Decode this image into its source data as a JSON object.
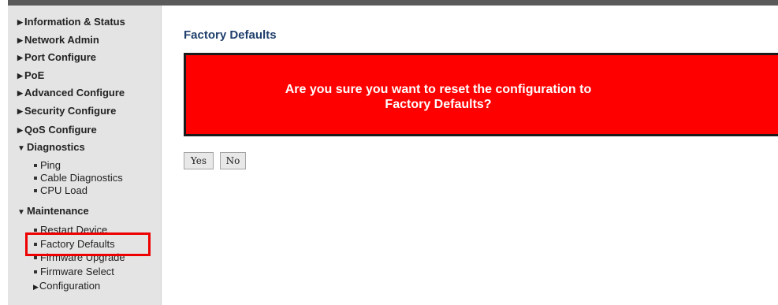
{
  "sidebar": {
    "items": [
      {
        "label": "Information & Status"
      },
      {
        "label": "Network Admin"
      },
      {
        "label": "Port Configure"
      },
      {
        "label": "PoE"
      },
      {
        "label": "Advanced Configure"
      },
      {
        "label": "Security Configure"
      },
      {
        "label": "QoS Configure"
      },
      {
        "label": "Diagnostics",
        "children": [
          "Ping",
          "Cable Diagnostics",
          "CPU Load"
        ]
      },
      {
        "label": "Maintenance",
        "children": [
          "Restart Device",
          "Factory Defaults",
          "Firmware Upgrade",
          "Firmware Select",
          "Configuration"
        ]
      }
    ]
  },
  "main": {
    "title": "Factory Defaults",
    "warning_line1": "Are you sure you want to reset the configuration to",
    "warning_line2": "Factory Defaults?",
    "yes_label": "Yes",
    "no_label": "No"
  },
  "colors": {
    "warning_bg": "#ff0000",
    "title": "#1f3f6c",
    "highlight": "#ee0000",
    "sidebar_bg": "#e4e4e4"
  }
}
